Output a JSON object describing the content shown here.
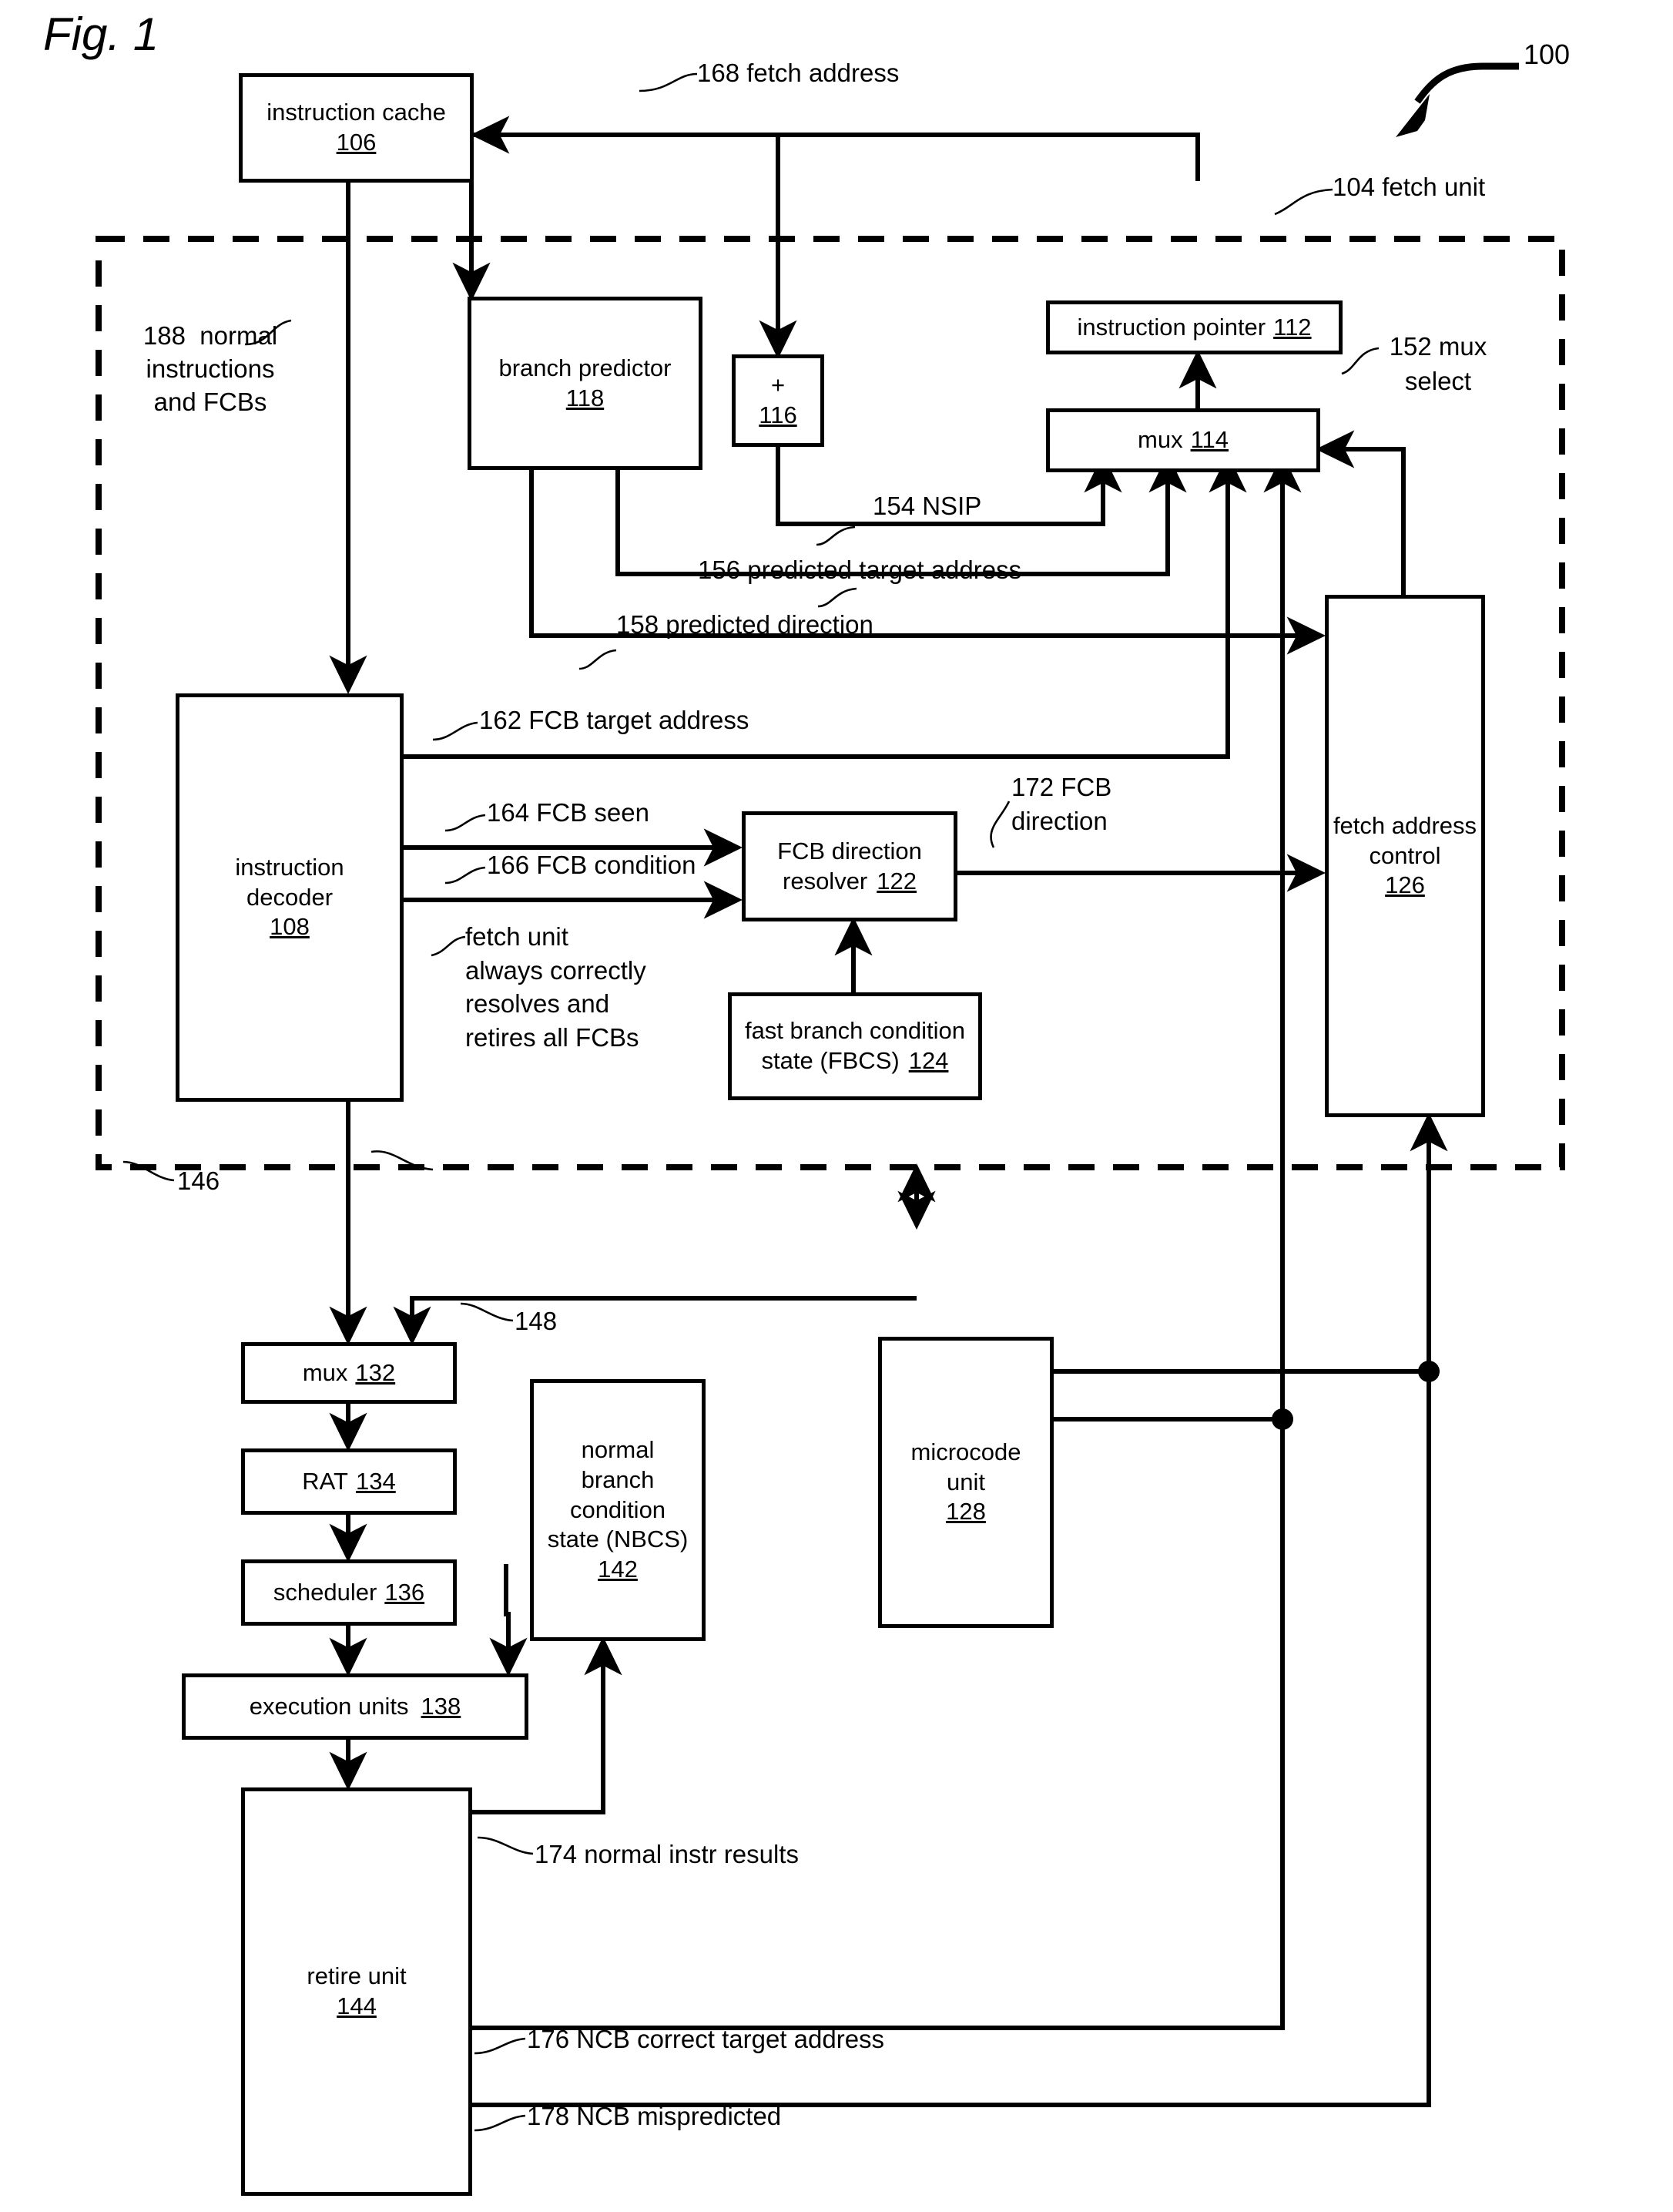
{
  "figure": {
    "title": "Fig. 1",
    "ref": "100"
  },
  "boundary": {
    "label": "104 fetch unit"
  },
  "blocks": {
    "instruction_cache": {
      "line1": "instruction cache",
      "num": "106"
    },
    "branch_predictor": {
      "line1": "branch predictor",
      "num": "118"
    },
    "adder": {
      "line1": "+",
      "num": "116"
    },
    "instruction_pointer": {
      "line1": "instruction pointer",
      "num": "112"
    },
    "mux114": {
      "line1": "mux",
      "num": "114"
    },
    "instruction_decoder": {
      "line1": "instruction",
      "line2": "decoder",
      "num": "108"
    },
    "fcb_direction_resolver": {
      "line1": "FCB direction",
      "line2": "resolver",
      "num": "122"
    },
    "fbcs": {
      "line1": "fast branch condition",
      "line2": "state (FBCS)",
      "num": "124"
    },
    "fetch_address_control": {
      "line1": "fetch address",
      "line2": "control",
      "num": "126"
    },
    "mux132": {
      "line1": "mux",
      "num": "132"
    },
    "rat134": {
      "line1": "RAT",
      "num": "134"
    },
    "scheduler136": {
      "line1": "scheduler",
      "num": "136"
    },
    "execution_units": {
      "line1": "execution units",
      "num": "138"
    },
    "nbcs": {
      "line1": "normal",
      "line2": "branch",
      "line3": "condition",
      "line4": "state (NBCS)",
      "num": "142"
    },
    "microcode_unit": {
      "line1": "microcode",
      "line2": "unit",
      "num": "128"
    },
    "retire_unit": {
      "line1": "retire unit",
      "num": "144"
    }
  },
  "signals": {
    "s168": "168 fetch address",
    "s188": "188  normal\ninstructions\nand FCBs",
    "s154": "154 NSIP",
    "s156": "156 predicted target address",
    "s158": "158 predicted direction",
    "s152": "152 mux\nselect",
    "s162": "162 FCB target address",
    "s164": "164 FCB seen",
    "s166": "166 FCB condition",
    "s172": "172 FCB\ndirection",
    "note_fetch_unit": "fetch unit\nalways correctly\nresolves and\nretires all FCBs",
    "s146": "146",
    "s148": "148",
    "s174": "174 normal instr results",
    "s176": "176 NCB correct target address",
    "s178": "178 NCB mispredicted"
  },
  "colors": {
    "ink": "#000000",
    "paper": "#ffffff"
  }
}
